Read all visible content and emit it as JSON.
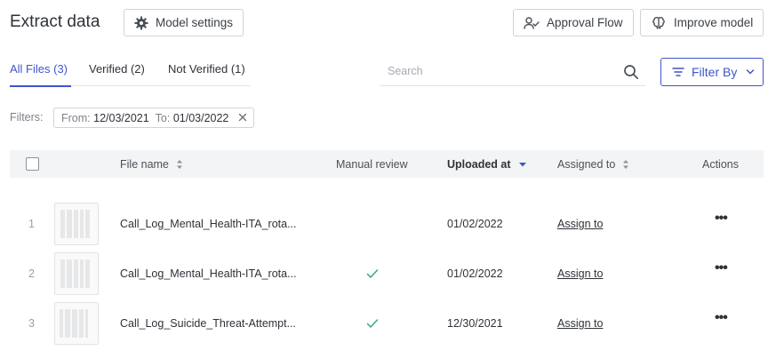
{
  "header": {
    "title": "Extract data",
    "model_settings_label": "Model settings",
    "approval_flow_label": "Approval Flow",
    "improve_model_label": "Improve model"
  },
  "tabs": [
    {
      "label": "All Files (3)",
      "active": true
    },
    {
      "label": "Verified (2)",
      "active": false
    },
    {
      "label": "Not Verified (1)",
      "active": false
    }
  ],
  "search": {
    "placeholder": "Search",
    "value": ""
  },
  "filter_button": {
    "label": "Filter By"
  },
  "filters": {
    "label": "Filters:",
    "chip": {
      "from_label": "From:",
      "from_value": "12/03/2021",
      "to_label": "To:",
      "to_value": "01/03/2022"
    }
  },
  "table": {
    "headers": {
      "file_name": "File name",
      "manual_review": "Manual review",
      "uploaded_at": "Uploaded at",
      "assigned_to": "Assigned to",
      "actions": "Actions"
    },
    "rows": [
      {
        "num": "1",
        "file_name": "Call_Log_Mental_Health-ITA_rota...",
        "manual_review": false,
        "uploaded_at": "01/02/2022",
        "assign": "Assign to",
        "actions": "•••"
      },
      {
        "num": "2",
        "file_name": "Call_Log_Mental_Health-ITA_rota...",
        "manual_review": true,
        "uploaded_at": "01/02/2022",
        "assign": "Assign to",
        "actions": "•••"
      },
      {
        "num": "3",
        "file_name": "Call_Log_Suicide_Threat-Attempt...",
        "manual_review": true,
        "uploaded_at": "12/30/2021",
        "assign": "Assign to",
        "actions": "•••"
      }
    ]
  },
  "colors": {
    "accent": "#3f55c9",
    "check": "#3aa77a",
    "header_bg": "#f3f4f6"
  },
  "icons": {
    "model_settings": "gear-icon",
    "approval_flow": "user-check-icon",
    "improve_model": "brain-icon",
    "search": "search-icon",
    "filter": "filter-lines-icon",
    "chip_close": "close-icon",
    "sort": "sort-icon",
    "review": "checkmark-icon",
    "actions": "more-dots-icon"
  }
}
